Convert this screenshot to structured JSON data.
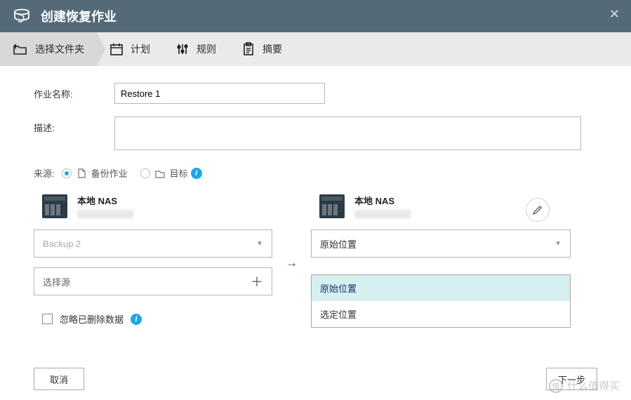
{
  "titlebar": {
    "title": "创建恢复作业"
  },
  "steps": [
    {
      "label": "选择文件夹",
      "active": true
    },
    {
      "label": "计划",
      "active": false
    },
    {
      "label": "规则",
      "active": false
    },
    {
      "label": "摘要",
      "active": false
    }
  ],
  "form": {
    "name_label": "作业名称:",
    "name_value": "Restore 1",
    "desc_label": "描述:",
    "desc_value": ""
  },
  "source": {
    "label": "来源:",
    "opt_backup": "备份作业",
    "opt_target": "目标"
  },
  "left": {
    "nas_title": "本地 NAS",
    "select_value": "Backup 2",
    "choose_source": "选择源"
  },
  "right": {
    "nas_title": "本地 NAS",
    "select_value": "原始位置",
    "dropdown": [
      "原始位置",
      "选定位置"
    ]
  },
  "ignore_label": "忽略已删除数据",
  "footer": {
    "cancel": "取消",
    "next": "下一步"
  },
  "watermark": {
    "text": "什么值得买",
    "logo": "值"
  }
}
